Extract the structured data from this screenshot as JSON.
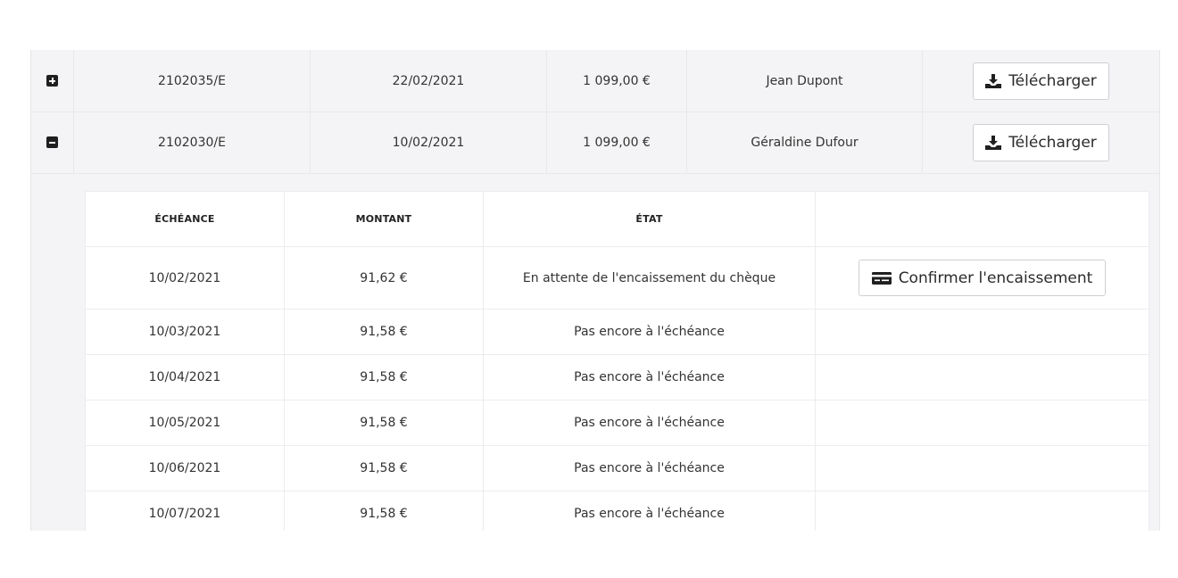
{
  "orders": [
    {
      "toggle_icon": "plus-square-icon",
      "number": "2102035/E",
      "date": "22/02/2021",
      "amount": "1 099,00 €",
      "customer": "Jean Dupont",
      "download_label": "Télécharger"
    },
    {
      "toggle_icon": "minus-square-icon",
      "number": "2102030/E",
      "date": "10/02/2021",
      "amount": "1 099,00 €",
      "customer": "Géraldine Dufour",
      "download_label": "Télécharger"
    }
  ],
  "schedule": {
    "headers": [
      "ÉCHÉANCE",
      "MONTANT",
      "ÉTAT",
      ""
    ],
    "confirm_label": "Confirmer l'encaissement",
    "pending_color": "#d9363e",
    "rows": [
      {
        "due_date": "10/02/2021",
        "amount": "91,62 €",
        "state": "En attente de l'encaissement du chèque"
      },
      {
        "due_date": "10/03/2021",
        "amount": "91,58 €",
        "state": "Pas encore à l'échéance"
      },
      {
        "due_date": "10/04/2021",
        "amount": "91,58 €",
        "state": "Pas encore à l'échéance"
      },
      {
        "due_date": "10/05/2021",
        "amount": "91,58 €",
        "state": "Pas encore à l'échéance"
      },
      {
        "due_date": "10/06/2021",
        "amount": "91,58 €",
        "state": "Pas encore à l'échéance"
      },
      {
        "due_date": "10/07/2021",
        "amount": "91,58 €",
        "state": "Pas encore à l'échéance"
      }
    ]
  }
}
